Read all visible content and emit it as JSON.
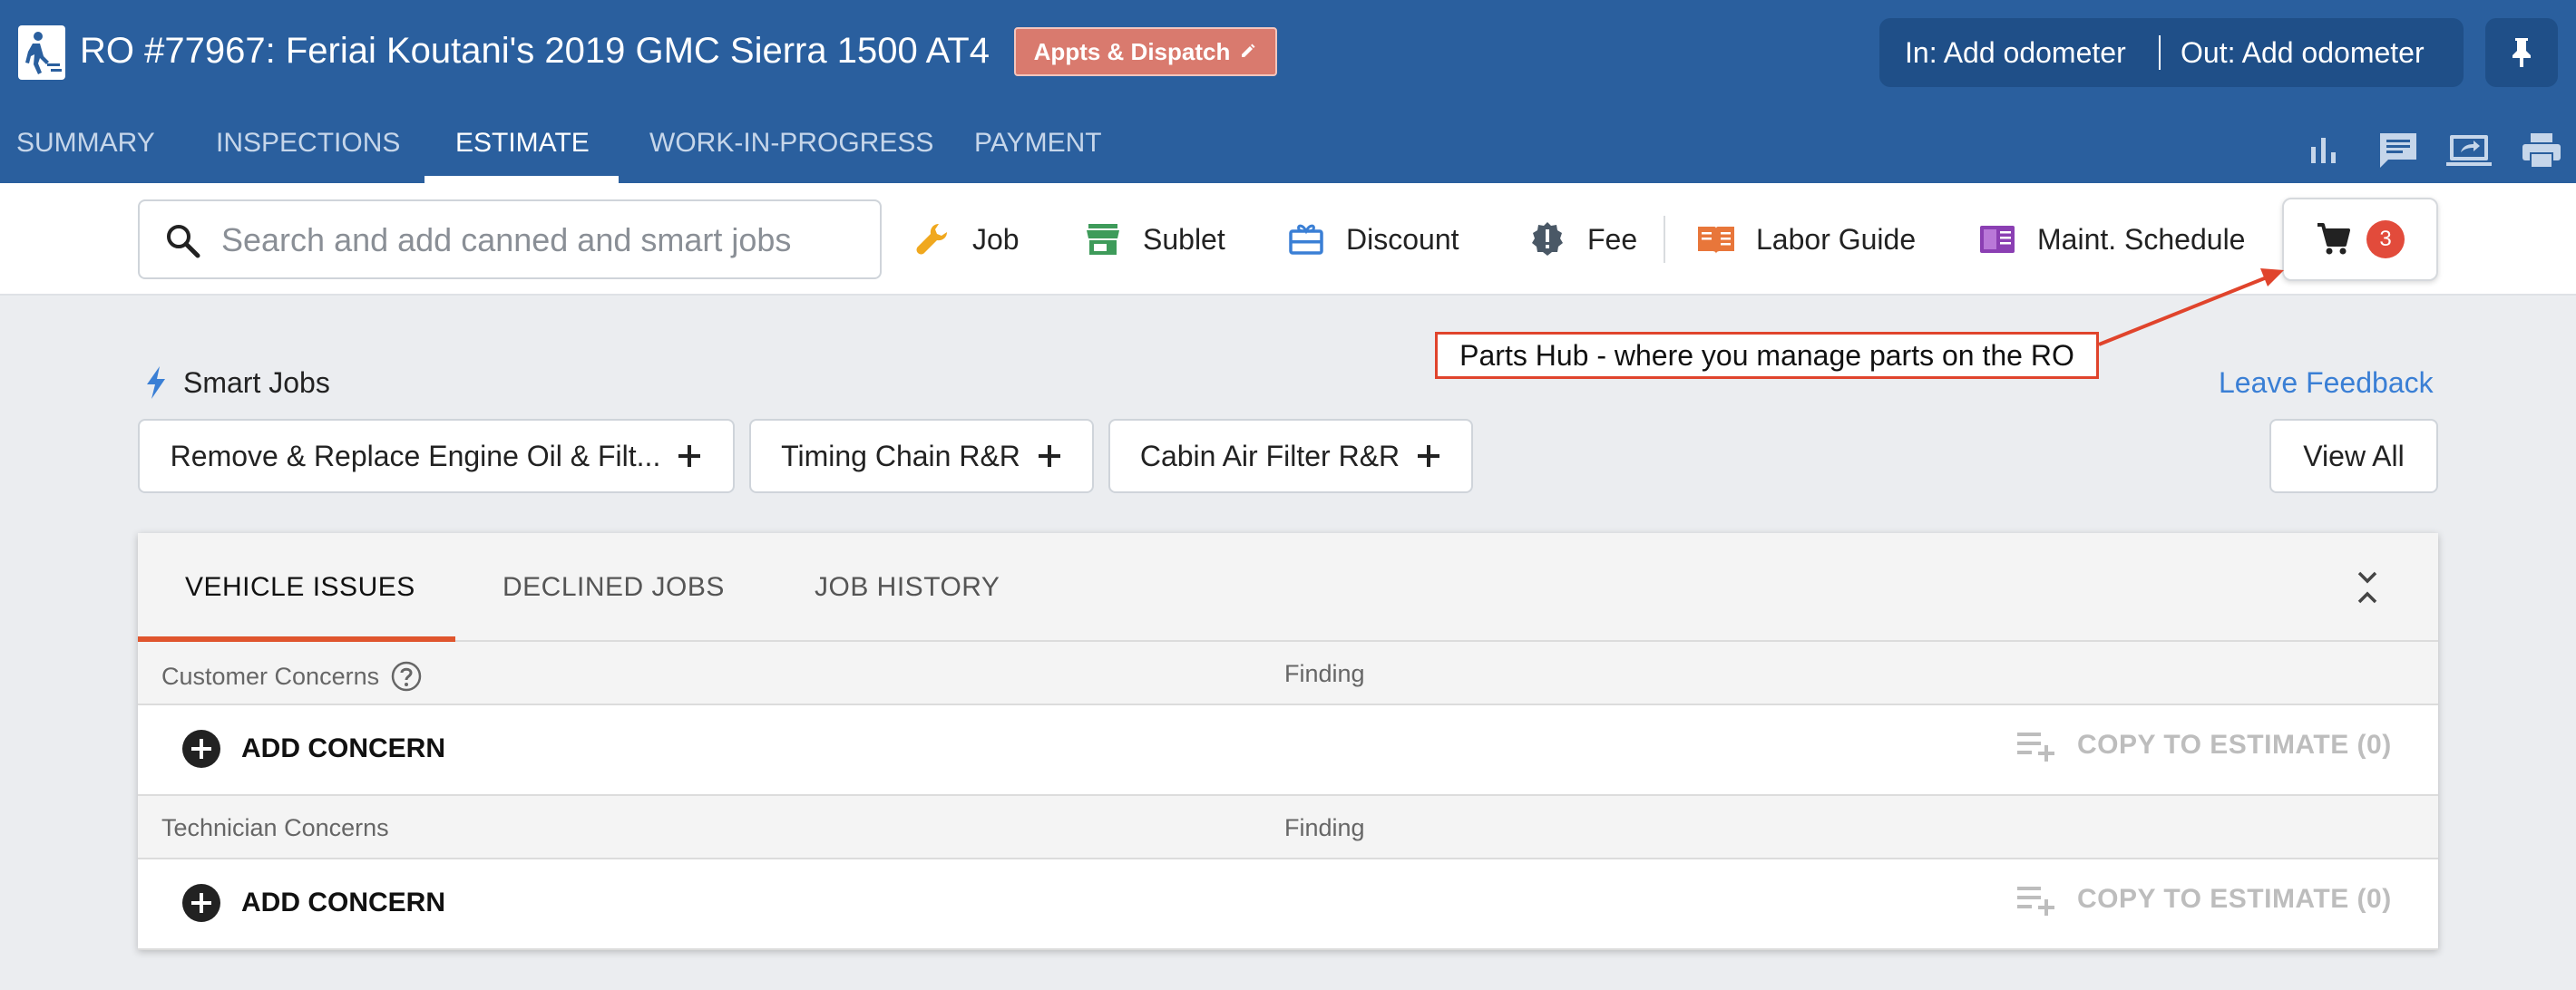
{
  "header": {
    "title": "RO #77967: Feriai Koutani's 2019 GMC Sierra 1500 AT4",
    "appts_label": "Appts & Dispatch",
    "odometer_in": "In: Add odometer",
    "odometer_out": "Out: Add odometer",
    "tabs": [
      {
        "label": "SUMMARY"
      },
      {
        "label": "INSPECTIONS"
      },
      {
        "label": "ESTIMATE"
      },
      {
        "label": "WORK-IN-PROGRESS"
      },
      {
        "label": "PAYMENT"
      }
    ],
    "active_tab": "ESTIMATE",
    "icons": [
      "bar-chart-icon",
      "message-icon",
      "screen-share-icon",
      "print-icon"
    ]
  },
  "toolbar": {
    "search_placeholder": "Search and add canned and smart jobs",
    "job_label": "Job",
    "sublet_label": "Sublet",
    "discount_label": "Discount",
    "fee_label": "Fee",
    "labor_guide_label": "Labor Guide",
    "maint_schedule_label": "Maint. Schedule",
    "cart_count": "3"
  },
  "annotation": {
    "text": "Parts Hub - where you manage parts on the RO",
    "color": "#e0442c"
  },
  "smart_jobs": {
    "title": "Smart Jobs",
    "leave_feedback": "Leave Feedback",
    "chips": [
      {
        "label": "Remove & Replace Engine Oil & Filt..."
      },
      {
        "label": "Timing Chain R&R"
      },
      {
        "label": "Cabin Air Filter R&R"
      }
    ],
    "view_all": "View All"
  },
  "panel": {
    "tabs": [
      {
        "label": "VEHICLE ISSUES"
      },
      {
        "label": "DECLINED JOBS"
      },
      {
        "label": "JOB HISTORY"
      }
    ],
    "active_tab": "VEHICLE ISSUES",
    "sections": [
      {
        "title": "Customer Concerns",
        "finding": "Finding",
        "add_label": "ADD CONCERN",
        "copy_label": "COPY TO ESTIMATE (0)"
      },
      {
        "title": "Technician Concerns",
        "finding": "Finding",
        "add_label": "ADD CONCERN",
        "copy_label": "COPY TO ESTIMATE (0)"
      }
    ]
  },
  "colors": {
    "header_bg": "#2a5f9e",
    "accent_underline": "#e0552d",
    "badge": "#e24b3b",
    "link": "#3a7fd5"
  }
}
